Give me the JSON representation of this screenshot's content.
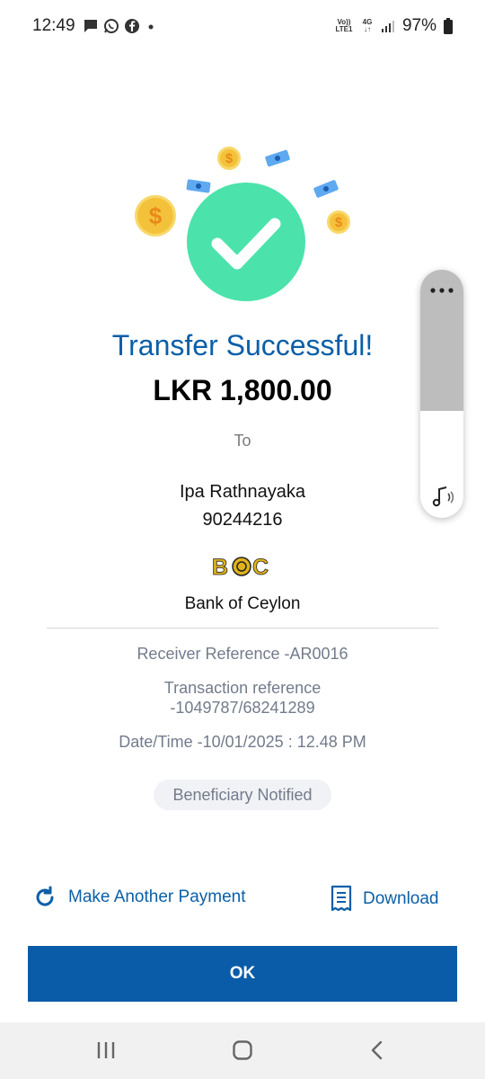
{
  "status_bar": {
    "time": "12:49",
    "notification_icons": [
      "message-icon",
      "whatsapp-icon",
      "facebook-icon",
      "dot-icon"
    ],
    "volte_label": "Vo)) LTE1",
    "network_label": "4G",
    "battery": "97%"
  },
  "success": {
    "title": "Transfer Successful!",
    "amount": "LKR 1,800.00",
    "to_label": "To",
    "recipient_name": "Ipa Rathnayaka",
    "recipient_account": "90244216",
    "bank_logo_text": "BOC",
    "bank_name": "Bank of Ceylon"
  },
  "details": {
    "receiver_reference": "Receiver Reference -AR0016",
    "transaction_reference_label": "Transaction reference",
    "transaction_reference_value": "-1049787/68241289",
    "date_time": "Date/Time -10/01/2025 : 12.48 PM",
    "notified_badge": "Beneficiary Notified"
  },
  "actions": {
    "make_another": "Make Another Payment",
    "download": "Download",
    "ok": "OK"
  },
  "volume_panel": {
    "level": 0.57
  },
  "colors": {
    "accent": "#0b5fa8",
    "success_green": "#4be3ab",
    "coin_gold": "#f4c23a",
    "muted_text": "#737b8c"
  }
}
